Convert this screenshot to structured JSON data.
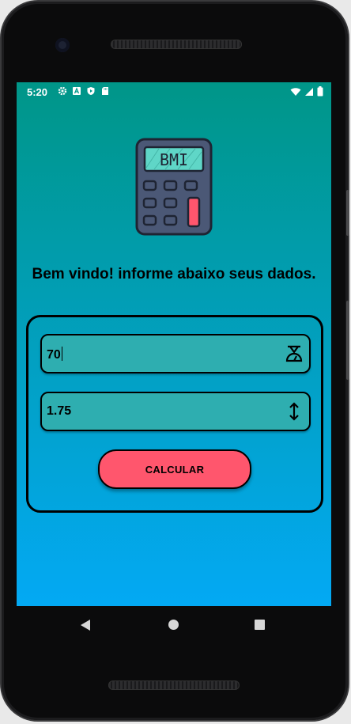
{
  "status_bar": {
    "time": "5:20",
    "left_icons": [
      "gear-icon",
      "a-icon",
      "shield-icon",
      "sd-card-icon"
    ],
    "right_icons": [
      "wifi-icon",
      "signal-icon",
      "battery-icon"
    ]
  },
  "logo": {
    "text": "BMI"
  },
  "welcome_text": "Bem vindo! informe abaixo seus dados.",
  "form": {
    "weight": {
      "value": "70",
      "icon": "scale-icon"
    },
    "height": {
      "value": "1.75",
      "icon": "up-down-arrow-icon"
    },
    "calculate_label": "CALCULAR"
  },
  "colors": {
    "gradient_top": "#009688",
    "gradient_bottom": "#03a9f4",
    "field_bg": "#2eaeb0",
    "button_bg": "#ff566d",
    "logo_body": "#4b5876",
    "logo_screen": "#5fd6c7",
    "logo_key_accent": "#ff566d"
  },
  "nav_bar": {
    "items": [
      "back-icon",
      "home-icon",
      "recents-icon"
    ]
  }
}
